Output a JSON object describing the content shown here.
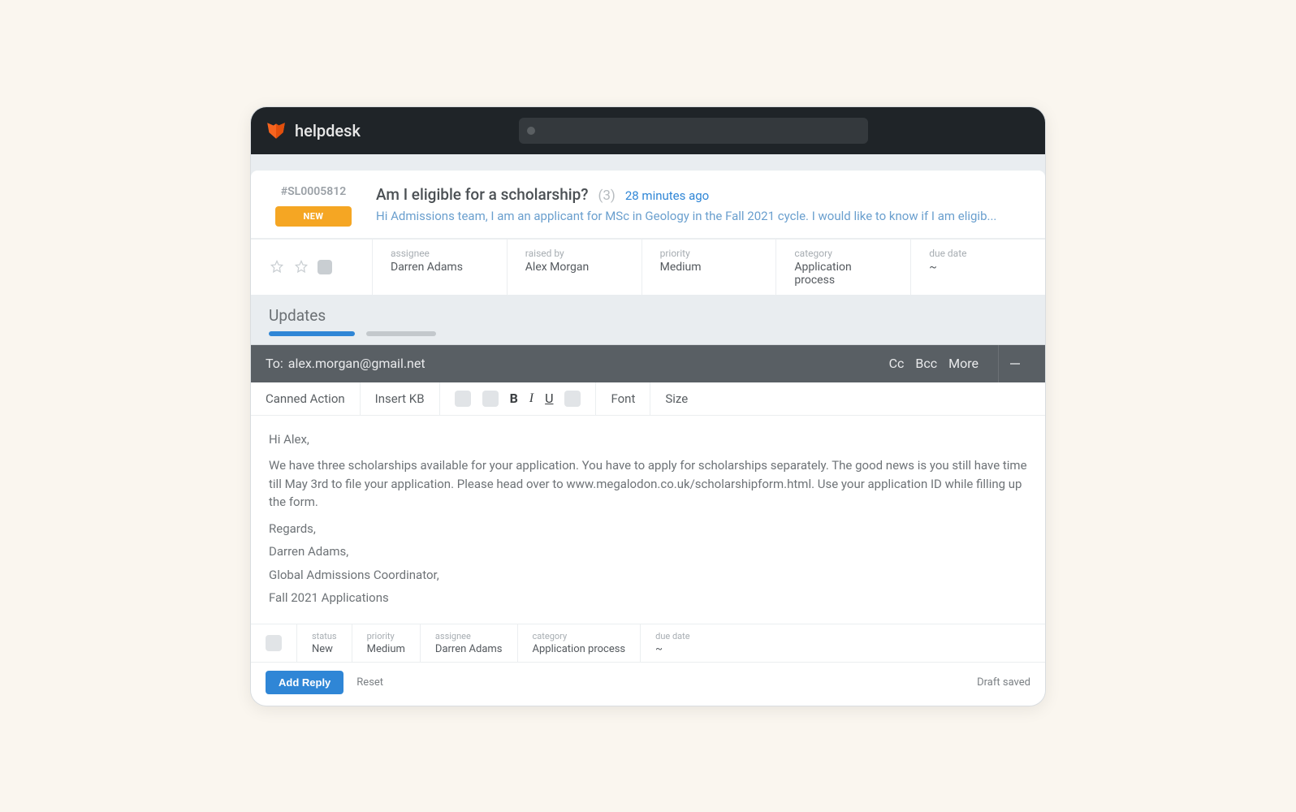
{
  "brand": "helpdesk",
  "ticket": {
    "id": "#SL0005812",
    "badge": "NEW",
    "title": "Am I eligible for a scholarship?",
    "count": "(3)",
    "time": "28 minutes ago",
    "preview": "Hi Admissions team, I am an applicant for MSc in Geology in the Fall 2021 cycle. I would like to know if I am eligib...",
    "meta": {
      "assignee_label": "assignee",
      "assignee": "Darren Adams",
      "raised_by_label": "raised by",
      "raised_by": "Alex Morgan",
      "priority_label": "priority",
      "priority": "Medium",
      "category_label": "category",
      "category": "Application process",
      "due_date_label": "due date",
      "due_date": "~"
    }
  },
  "tabs": {
    "title": "Updates"
  },
  "compose": {
    "to_label": "To:",
    "to": "alex.morgan@gmail.net",
    "cc": "Cc",
    "bcc": "Bcc",
    "more": "More",
    "toolbar": {
      "canned": "Canned Action",
      "insert_kb": "Insert KB",
      "bold": "B",
      "italic": "I",
      "underline": "U",
      "font": "Font",
      "size": "Size"
    },
    "body": {
      "greeting": "Hi Alex,",
      "para": "We have three scholarships available for your application. You have to apply for scholarships separately. The good news is you still have time till May 3rd to file your application. Please head over to www.megalodon.co.uk/scholarshipform.html. Use your application ID while filling up the form.",
      "regards": "Regards,",
      "sig1": "Darren Adams,",
      "sig2": "Global Admissions Coordinator,",
      "sig3": "Fall 2021 Applications"
    },
    "meta": {
      "status_label": "status",
      "status": "New",
      "priority_label": "priority",
      "priority": "Medium",
      "assignee_label": "assignee",
      "assignee": "Darren Adams",
      "category_label": "category",
      "category": "Application process",
      "due_date_label": "due date",
      "due_date": "~"
    },
    "footer": {
      "add_reply": "Add Reply",
      "reset": "Reset",
      "draft_status": "Draft saved"
    }
  }
}
